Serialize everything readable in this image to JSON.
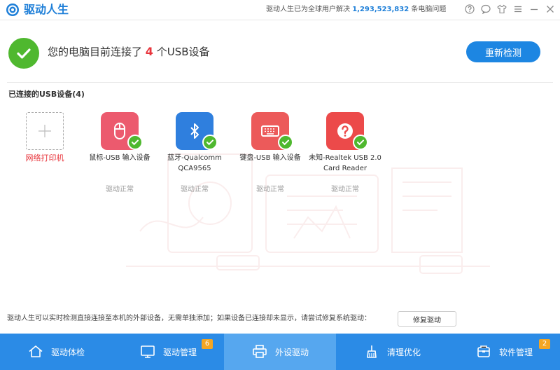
{
  "app": {
    "title": "驱动人生",
    "stats_prefix": "驱动人生已为全球用户解决",
    "stats_count": "1,293,523,832",
    "stats_suffix": "条电脑问题"
  },
  "status": {
    "prefix": "您的电脑目前连接了",
    "count": "4",
    "suffix": "个USB设备",
    "recheck_label": "重新检测"
  },
  "section_title": "已连接的USB设备(4)",
  "add_device": {
    "label": "网络打印机"
  },
  "devices": [
    {
      "name": "鼠标-USB 输入设备",
      "status": "驱动正常",
      "icon": "mouse-icon",
      "color": "#ec5a6e"
    },
    {
      "name": "蓝牙-Qualcomm QCA9565",
      "status": "驱动正常",
      "icon": "bluetooth-icon",
      "color": "#2f7fde"
    },
    {
      "name": "键盘-USB 输入设备",
      "status": "驱动正常",
      "icon": "keyboard-icon",
      "color": "#ec5a5a"
    },
    {
      "name": "未知-Realtek USB 2.0 Card Reader",
      "status": "驱动正常",
      "icon": "question-icon",
      "color": "#ec4a4a"
    }
  ],
  "hint": "驱动人生可以实时检测直接连接至本机的外部设备，无需单独添加；如果设备已连接却未显示，请尝试修复系统驱动：",
  "repair_label": "修复驱动",
  "nav": [
    {
      "label": "驱动体检",
      "icon": "home-icon",
      "badge": ""
    },
    {
      "label": "驱动管理",
      "icon": "monitor-icon",
      "badge": "6"
    },
    {
      "label": "外设驱动",
      "icon": "printer-icon",
      "badge": ""
    },
    {
      "label": "清理优化",
      "icon": "broom-icon",
      "badge": ""
    },
    {
      "label": "软件管理",
      "icon": "software-icon",
      "badge": "2"
    }
  ],
  "colors": {
    "brand": "#1e7fd8",
    "nav_bg": "#2b8be6",
    "nav_active": "#56a7ef",
    "ok_green": "#4fb82f",
    "alert_red": "#e8353c",
    "badge": "#f5a623"
  }
}
